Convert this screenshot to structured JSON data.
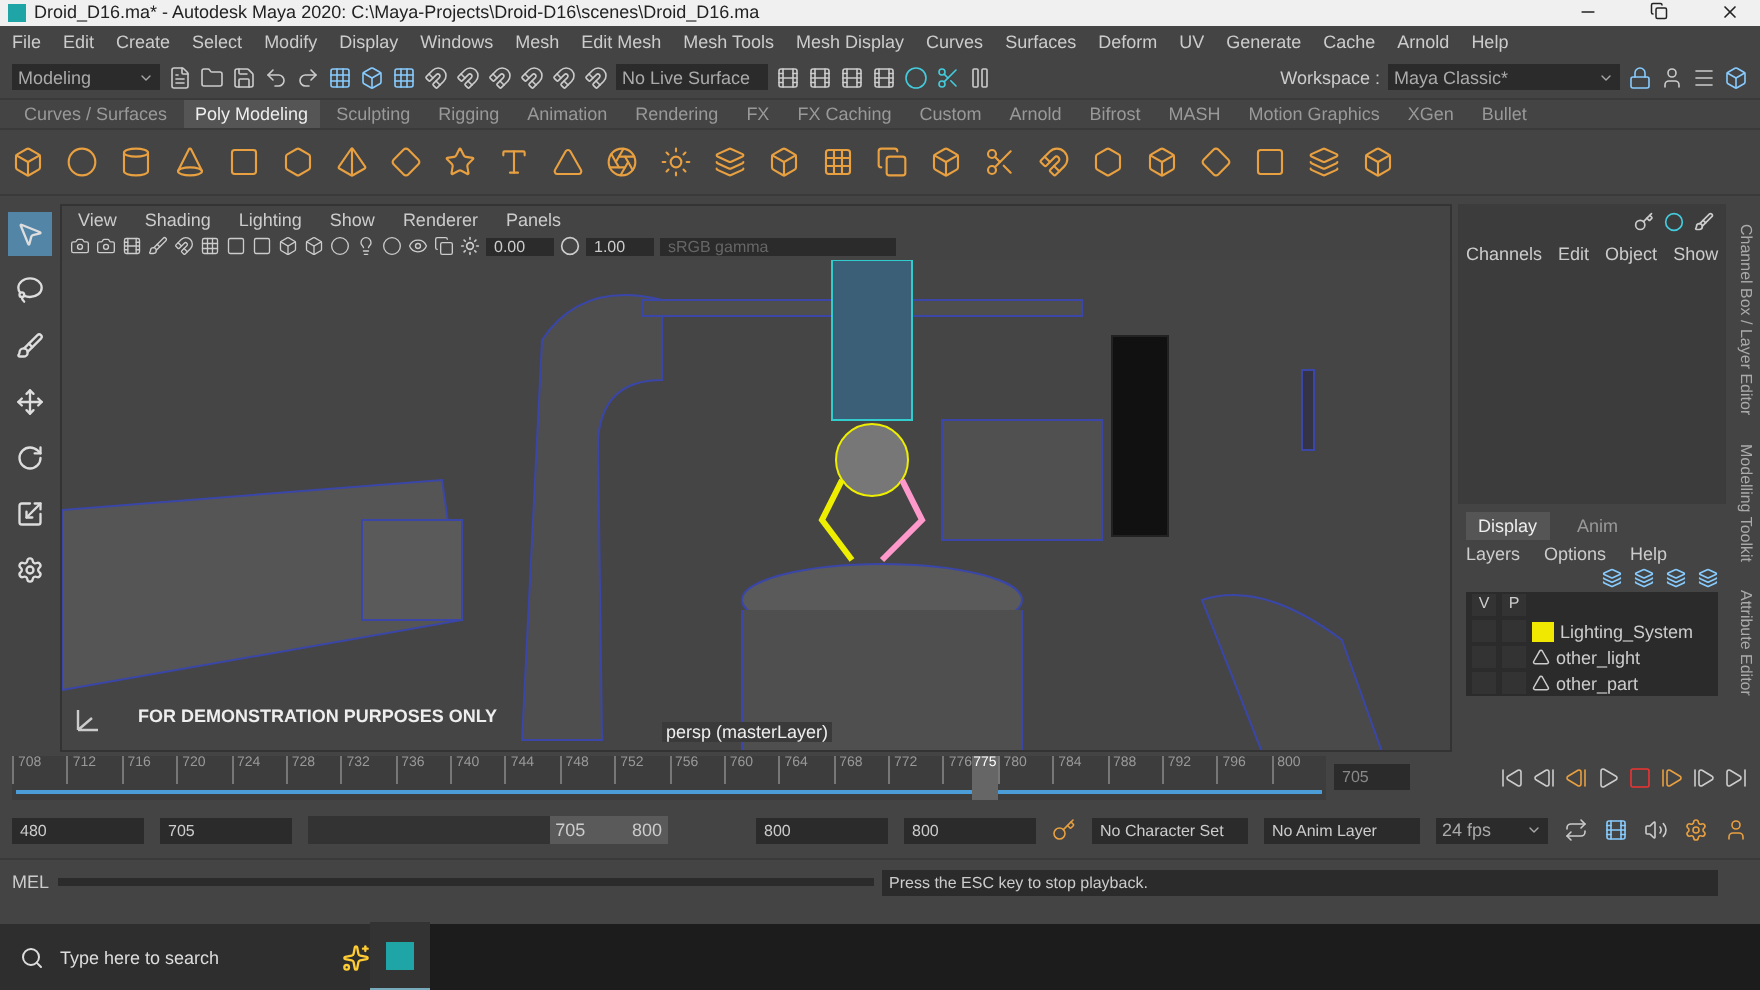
{
  "window": {
    "title": "Droid_D16.ma* - Autodesk Maya 2020: C:\\Maya-Projects\\Droid-D16\\scenes\\Droid_D16.ma"
  },
  "menu_bar": [
    "File",
    "Edit",
    "Create",
    "Select",
    "Modify",
    "Display",
    "Windows",
    "Mesh",
    "Edit Mesh",
    "Mesh Tools",
    "Mesh Display",
    "Curves",
    "Surfaces",
    "Deform",
    "UV",
    "Generate",
    "Cache",
    "Arnold",
    "Help"
  ],
  "status_line": {
    "menu_set": "Modeling",
    "live_surface": "No Live Surface",
    "workspace_label": "Workspace :",
    "workspace": "Maya Classic*"
  },
  "shelf_tabs": [
    {
      "label": "Curves / Surfaces",
      "selected": false
    },
    {
      "label": "Poly Modeling",
      "selected": true
    },
    {
      "label": "Sculpting",
      "selected": false
    },
    {
      "label": "Rigging",
      "selected": false
    },
    {
      "label": "Animation",
      "selected": false
    },
    {
      "label": "Rendering",
      "selected": false
    },
    {
      "label": "FX",
      "selected": false
    },
    {
      "label": "FX Caching",
      "selected": false
    },
    {
      "label": "Custom",
      "selected": false
    },
    {
      "label": "Arnold",
      "selected": false
    },
    {
      "label": "Bifrost",
      "selected": false
    },
    {
      "label": "MASH",
      "selected": false
    },
    {
      "label": "Motion Graphics",
      "selected": false
    },
    {
      "label": "XGen",
      "selected": false
    },
    {
      "label": "Bullet",
      "selected": false
    }
  ],
  "tools": [
    {
      "kind": "select",
      "selected": true
    },
    {
      "kind": "lasso",
      "selected": false
    },
    {
      "kind": "paint",
      "selected": false
    },
    {
      "kind": "move",
      "selected": false
    },
    {
      "kind": "rotate",
      "selected": false
    },
    {
      "kind": "scale",
      "selected": false
    }
  ],
  "viewport": {
    "menus": [
      "View",
      "Shading",
      "Lighting",
      "Show",
      "Renderer",
      "Panels"
    ],
    "exposure": "0.00",
    "gamma": "1.00",
    "color_space": "sRGB gamma",
    "notice": "FOR DEMONSTRATION PURPOSES ONLY",
    "camera": "persp (masterLayer)"
  },
  "channel_box": {
    "menus": [
      "Channels",
      "Edit",
      "Object",
      "Show"
    ]
  },
  "layer_editor": {
    "tabs": [
      {
        "label": "Display",
        "selected": true
      },
      {
        "label": "Anim",
        "selected": false
      }
    ],
    "menus": [
      "Layers",
      "Options",
      "Help"
    ],
    "headers": [
      "V",
      "P"
    ],
    "layers": [
      {
        "name": "Lighting_System",
        "kind": "color",
        "color": "#f0e800"
      },
      {
        "name": "other_light",
        "kind": "plain"
      },
      {
        "name": "other_part",
        "kind": "plain"
      }
    ]
  },
  "side_tabs": [
    "Channel Box / Layer Editor",
    "Modelling Toolkit",
    "Attribute Editor"
  ],
  "time_slider": {
    "ticks": [
      "708",
      "712",
      "716",
      "720",
      "724",
      "728",
      "732",
      "736",
      "740",
      "744",
      "748",
      "752",
      "756",
      "760",
      "764",
      "768",
      "772",
      "776",
      "780",
      "784",
      "788",
      "792",
      "796",
      "800"
    ],
    "current": "775",
    "level": 0.73,
    "current_frame": "705"
  },
  "range_slider": {
    "level": 0.33,
    "start": "480",
    "inner_start": "705",
    "range_start": "705",
    "range_end": "800",
    "inner_end": "800",
    "end": "800",
    "character_set": "No Character Set",
    "anim_layer": "No Anim Layer",
    "fps": "24 fps"
  },
  "command_line": {
    "language": "MEL",
    "help": "Press the ESC key to stop playback."
  },
  "taskbar": {
    "search_placeholder": "Type here to search"
  }
}
